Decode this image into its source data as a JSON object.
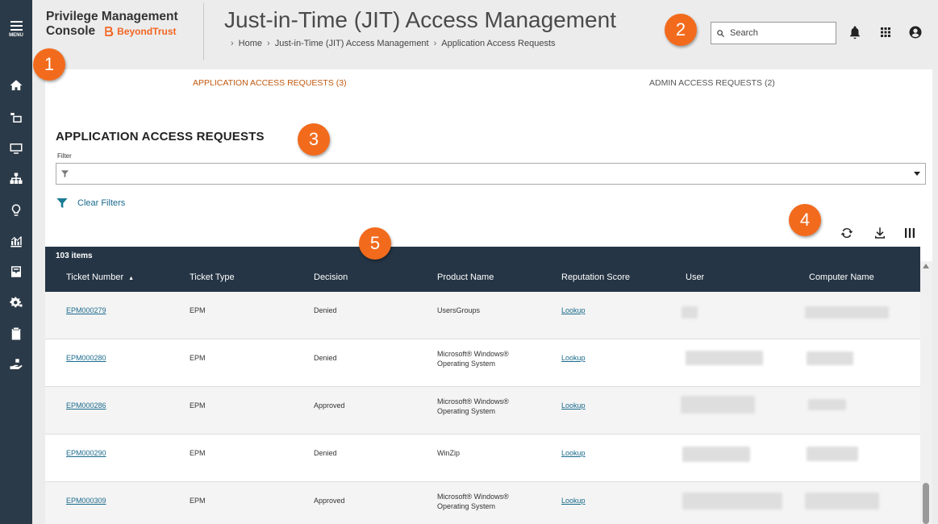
{
  "sidebar": {
    "menu_label": "MENU",
    "items": [
      "home-icon",
      "computer-groups-icon",
      "computers-icon",
      "hierarchy-icon",
      "lightbulb-icon",
      "reports-icon",
      "inbox-icon",
      "settings-icon",
      "clipboard-icon",
      "access-request-icon"
    ]
  },
  "header": {
    "brand_line1": "Privilege Management",
    "brand_line2": "Console",
    "logo_text": "BeyondTrust",
    "title": "Just-in-Time (JIT) Access Management",
    "breadcrumb": [
      "Home",
      "Just-in-Time (JIT) Access Management",
      "Application Access Requests"
    ],
    "search_placeholder": "Search"
  },
  "badges": [
    "1",
    "2",
    "3",
    "4",
    "5"
  ],
  "tabs": [
    {
      "label": "APPLICATION ACCESS REQUESTS (3)",
      "active": true
    },
    {
      "label": "ADMIN ACCESS REQUESTS (2)",
      "active": false
    }
  ],
  "section": {
    "title": "APPLICATION ACCESS REQUESTS",
    "filter_label": "Filter",
    "clear_filters": "Clear Filters"
  },
  "grid": {
    "items_count": "103 items",
    "columns": [
      "Ticket Number",
      "Ticket Type",
      "Decision",
      "Product Name",
      "Reputation Score",
      "User",
      "Computer Name"
    ],
    "sort_indicator": "▲",
    "rows": [
      {
        "ticket": "EPM000279",
        "type": "EPM",
        "decision": "Denied",
        "product_l1": "UsersGroups",
        "product_l2": "",
        "reputation": "Lookup"
      },
      {
        "ticket": "EPM000280",
        "type": "EPM",
        "decision": "Denied",
        "product_l1": "Microsoft® Windows®",
        "product_l2": "Operating System",
        "reputation": "Lookup"
      },
      {
        "ticket": "EPM000286",
        "type": "EPM",
        "decision": "Approved",
        "product_l1": "Microsoft® Windows®",
        "product_l2": "Operating System",
        "reputation": "Lookup"
      },
      {
        "ticket": "EPM000290",
        "type": "EPM",
        "decision": "Denied",
        "product_l1": "WinZip",
        "product_l2": "",
        "reputation": "Lookup"
      },
      {
        "ticket": "EPM000309",
        "type": "EPM",
        "decision": "Approved",
        "product_l1": "Microsoft® Windows®",
        "product_l2": "Operating System",
        "reputation": "Lookup"
      }
    ]
  },
  "colors": {
    "sidebar_bg": "#2b3a48",
    "grid_header_bg": "#253545",
    "accent_orange": "#f26b1d",
    "active_tab": "#c0590f",
    "link": "#1a6a8c"
  }
}
